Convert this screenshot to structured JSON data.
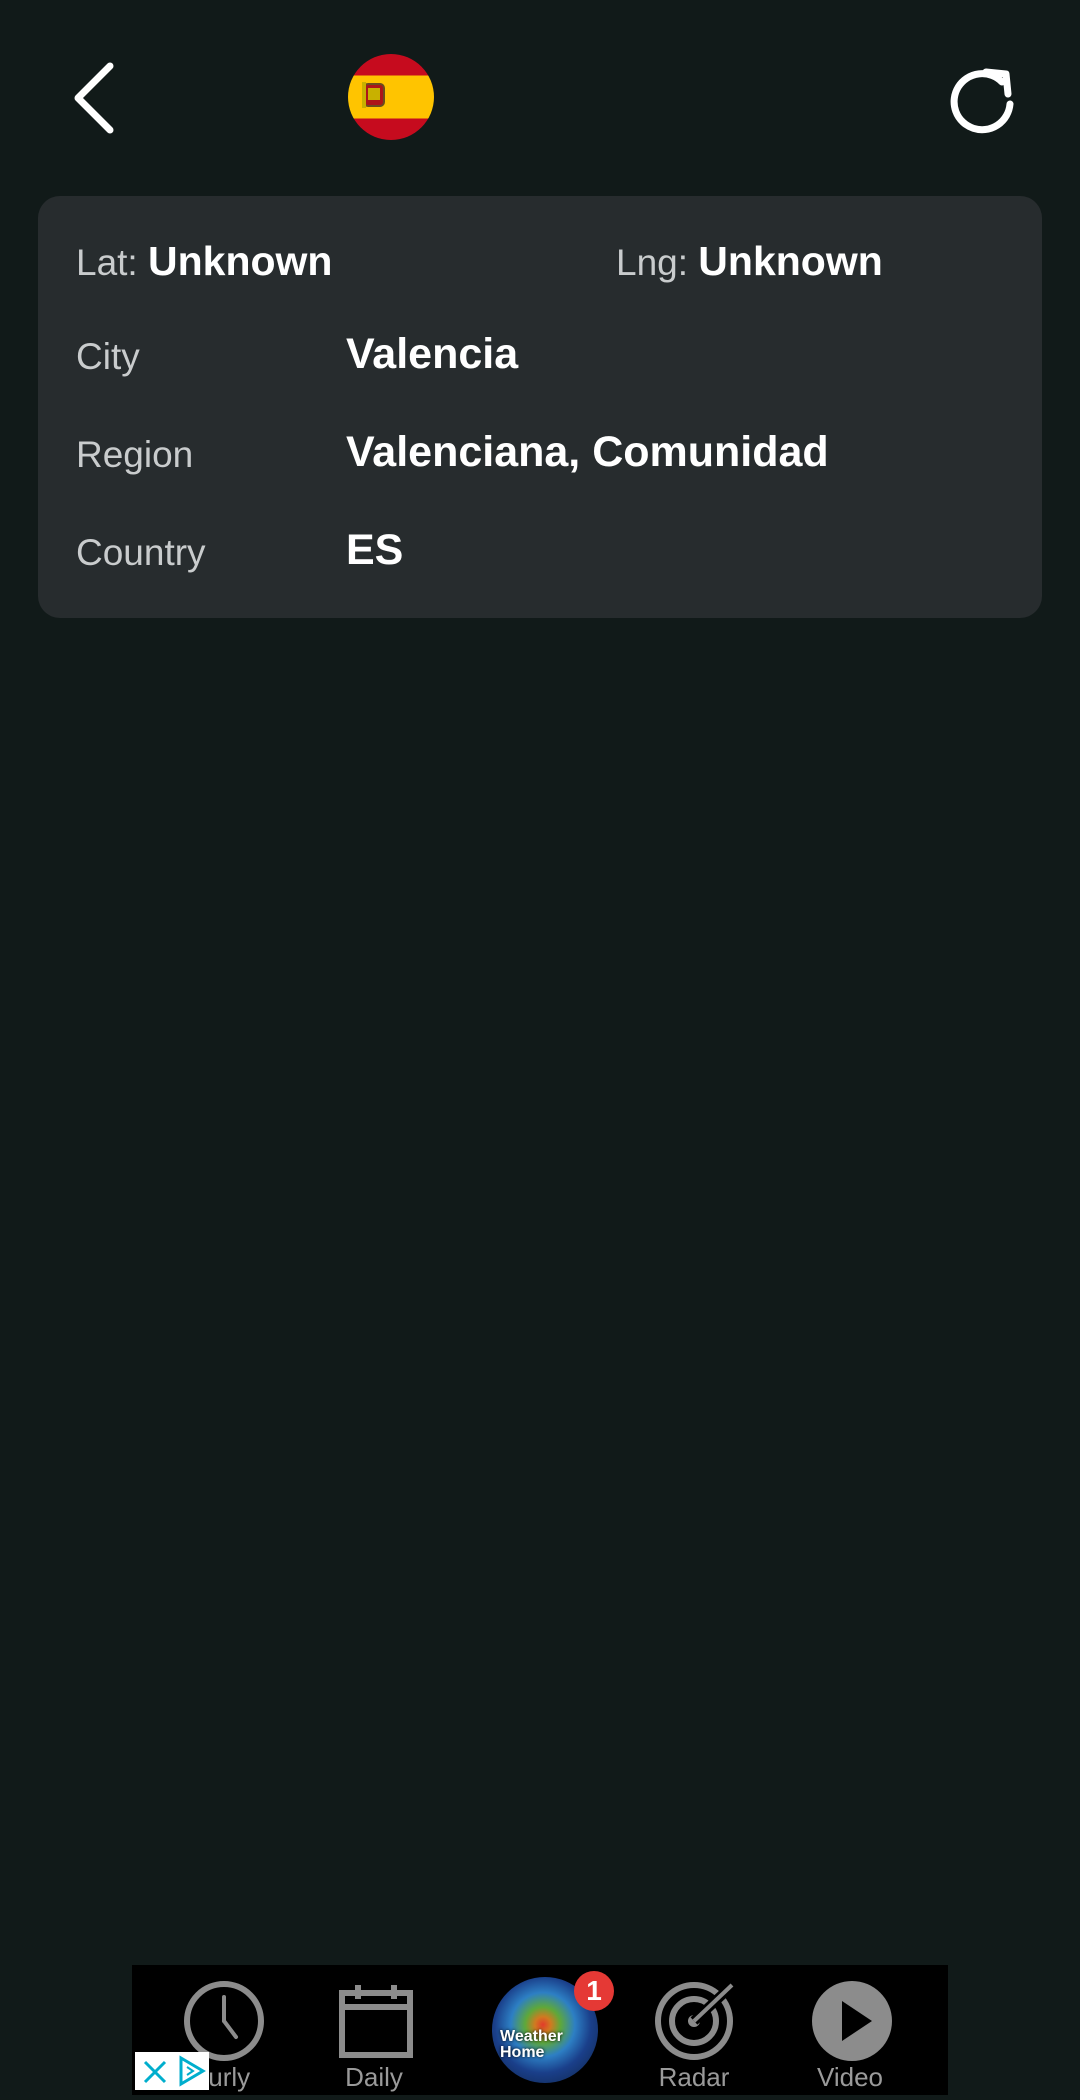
{
  "header": {
    "back_icon": "chevron-left-icon",
    "flag_icon": "spain-flag-icon",
    "refresh_icon": "refresh-icon"
  },
  "location": {
    "lat_label": "Lat:",
    "lat_value": "Unknown",
    "lng_label": "Lng:",
    "lng_value": "Unknown",
    "rows": [
      {
        "label": "City",
        "value": "Valencia"
      },
      {
        "label": "Region",
        "value": "Valenciana, Comunidad"
      },
      {
        "label": "Country",
        "value": "ES"
      }
    ]
  },
  "bottom_nav": {
    "items": [
      {
        "label": "ourly",
        "icon": "clock-icon"
      },
      {
        "label": "Daily",
        "icon": "calendar-icon"
      },
      {
        "label": "Weather Home",
        "icon": "weather-globe-icon",
        "badge": "1"
      },
      {
        "label": "Radar",
        "icon": "radar-icon"
      },
      {
        "label": "Video",
        "icon": "play-icon"
      }
    ]
  },
  "ad": {
    "icons": [
      "close-icon",
      "adchoices-icon"
    ]
  },
  "colors": {
    "background": "#111a19",
    "card": "#272c2e",
    "badge": "#e53935"
  }
}
